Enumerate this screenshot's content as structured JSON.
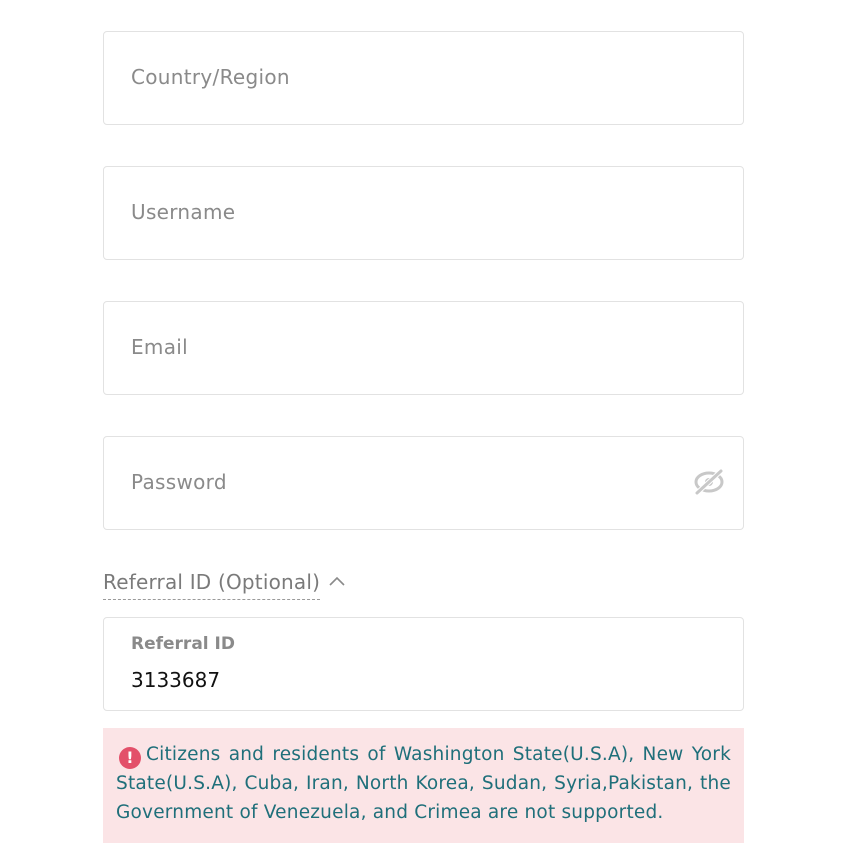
{
  "form": {
    "country_placeholder": "Country/Region",
    "username_placeholder": "Username",
    "email_placeholder": "Email",
    "password_placeholder": "Password",
    "password_visibility_icon": "eye-slash-icon"
  },
  "referral": {
    "toggle_label": "Referral ID (Optional)",
    "toggle_icon": "chevron-up-icon",
    "field_label": "Referral ID",
    "field_value": "3133687"
  },
  "notice": {
    "icon": "exclamation-circle-icon",
    "icon_glyph": "!",
    "text": "Citizens and residents of Washington State(U.S.A), New York State(U.S.A), Cuba, Iran, North Korea, Sudan, Syria,Pakistan, the Government of Venezuela, and Crimea are not supported."
  },
  "colors": {
    "notice_background": "#fbe4e6",
    "notice_text": "#1f6f7a",
    "warning_icon": "#e3506a",
    "field_border": "#e2e2e2",
    "placeholder": "#8a8a8a"
  }
}
